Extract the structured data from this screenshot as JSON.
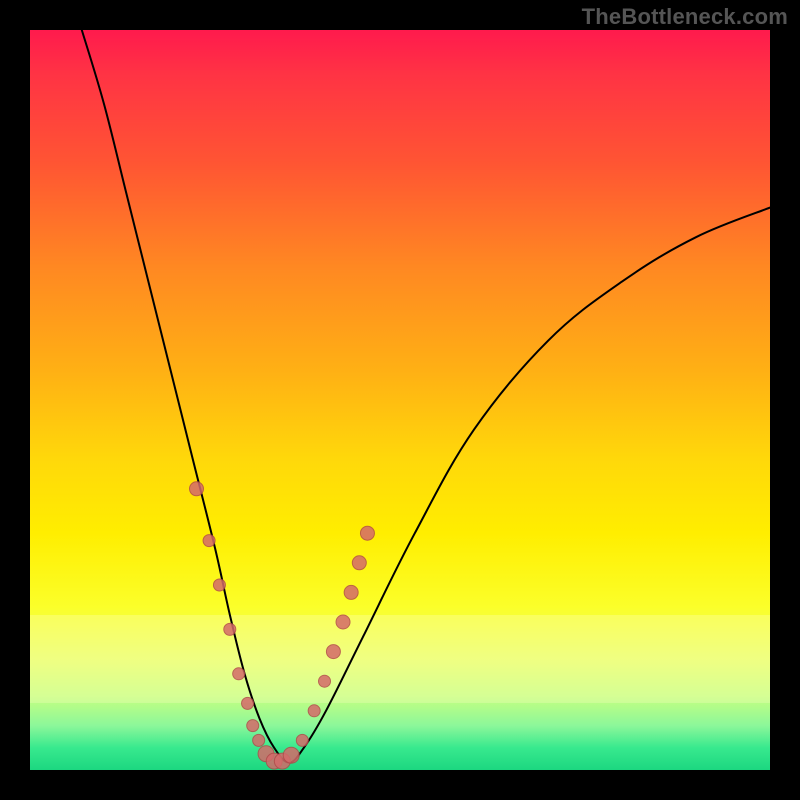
{
  "watermark": "TheBottleneck.com",
  "chart_data": {
    "type": "line",
    "title": "",
    "xlabel": "",
    "ylabel": "",
    "xlim": [
      0,
      100
    ],
    "ylim": [
      0,
      100
    ],
    "grid": false,
    "legend": false,
    "background_gradient": {
      "direction": "vertical",
      "stops": [
        {
          "pos": 0,
          "color": "#ff1a4d"
        },
        {
          "pos": 50,
          "color": "#ffcc00"
        },
        {
          "pos": 88,
          "color": "#f4ff60"
        },
        {
          "pos": 100,
          "color": "#1cd780"
        }
      ]
    },
    "light_band": {
      "y_from": 79,
      "y_to": 91
    },
    "series": [
      {
        "name": "bottleneck-curve",
        "x": [
          7,
          10,
          13,
          16,
          19,
          22,
          25,
          27,
          29,
          31,
          33,
          35,
          37,
          40,
          45,
          52,
          60,
          70,
          80,
          90,
          100
        ],
        "y": [
          100,
          90,
          78,
          66,
          54,
          42,
          30,
          21,
          13,
          7,
          3,
          1,
          3,
          8,
          18,
          32,
          46,
          58,
          66,
          72,
          76
        ]
      }
    ],
    "markers": {
      "name": "highlighted-points",
      "color": "#d46a6a",
      "x": [
        22.5,
        24.2,
        25.6,
        27.0,
        28.2,
        29.4,
        30.1,
        30.9,
        31.9,
        33.0,
        34.1,
        35.3,
        36.8,
        38.4,
        39.8,
        41.0,
        42.3,
        43.4,
        44.5,
        45.6
      ],
      "y": [
        38,
        31,
        25,
        19,
        13,
        9,
        6,
        4,
        2.2,
        1.2,
        1.2,
        2.0,
        4,
        8,
        12,
        16,
        20,
        24,
        28,
        32
      ],
      "r": [
        7,
        6,
        6,
        6,
        6,
        6,
        6,
        6,
        8,
        8,
        8,
        8,
        6,
        6,
        6,
        7,
        7,
        7,
        7,
        7
      ]
    }
  }
}
